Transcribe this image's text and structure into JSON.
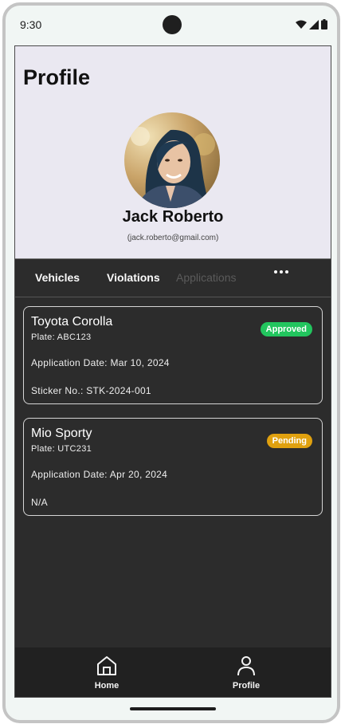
{
  "status_bar": {
    "time": "9:30"
  },
  "profile": {
    "title": "Profile",
    "name": "Jack Roberto",
    "email": "(jack.roberto@gmail.com)"
  },
  "tabs": [
    {
      "label": "Vehicles",
      "active": true
    },
    {
      "label": "Violations",
      "active": true
    },
    {
      "label": "Applications",
      "active": false
    }
  ],
  "applications": [
    {
      "vehicle": "Toyota Corolla",
      "plate": "Plate: ABC123",
      "date": "Application Date: Mar 10, 2024",
      "extra": "Sticker No.: STK-2024-001",
      "status": "Approved",
      "status_color": "#22c55e"
    },
    {
      "vehicle": "Mio Sporty",
      "plate": "Plate: UTC231",
      "date": "Application Date: Apr 20, 2024",
      "extra": "N/A",
      "status": "Pending",
      "status_color": "#e0a10f"
    }
  ],
  "bottom_nav": [
    {
      "label": "Home",
      "icon": "home-icon"
    },
    {
      "label": "Profile",
      "icon": "person-icon"
    }
  ]
}
